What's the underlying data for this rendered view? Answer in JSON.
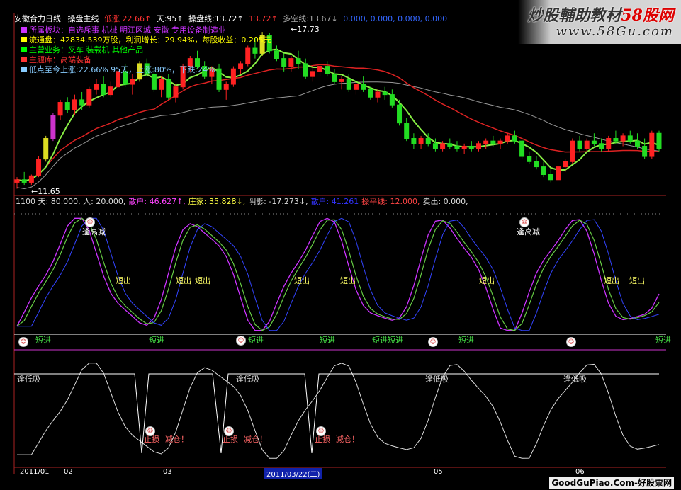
{
  "watermark": {
    "brand": "炒股輔助教材",
    "brand_num": "58股网",
    "url": "www.58Gu.com"
  },
  "top": {
    "title": "安徽合力日线",
    "ind": "操盘主线",
    "low_label": "低涨",
    "low_val": "22.66↑",
    "days": "天:95↑",
    "op_line": "操盘线:13.72↑",
    "op2": "13.72↑",
    "multi": "多空线:13.67↓",
    "zeros": "0.000, 0.000, 0.000, 0.000",
    "info": [
      {
        "text": "所属板块：自选斥事 机械 明江区城 安徽 专用设备制造业",
        "color": "#cc33ff"
      },
      {
        "text": "流通盘：42834.539万股，利润增长：29.94%，每股收益：0.205元",
        "color": "#ffff00"
      },
      {
        "text": "主营业务：叉车 装载机 其他产品",
        "color": "#00ff00"
      },
      {
        "text": "主题库：高端装备",
        "color": "#ff3333"
      },
      {
        "text": "低点至今上涨:22.66% 95天，上涨:80%，下跌:24%",
        "color": "#88ccff"
      }
    ],
    "high": "17.73",
    "low": "11.65"
  },
  "mid": {
    "header": [
      {
        "t": "1100 天: 80.000, 人: 20.000,",
        "c": "#ddd"
      },
      {
        "t": "散户: 46.627↑,",
        "c": "#ff44ff"
      },
      {
        "t": "庄家: 35.828↓,",
        "c": "#ffff44"
      },
      {
        "t": "阴影: -17.273↓,",
        "c": "#ddd"
      },
      {
        "t": "散户: 41.261",
        "c": "#3333ff"
      },
      {
        "t": "操平线: 12.000,",
        "c": "#ff4444"
      },
      {
        "t": "卖出: 0.000,",
        "c": "#ddd"
      }
    ],
    "sell_high": "逢高减",
    "short_out": "短出",
    "short_in": "短进"
  },
  "low": {
    "buy_low": "逢低吸",
    "stop": "止损",
    "reduce": "减仓！",
    "face": "☹"
  },
  "dates": [
    "2011/01",
    "02",
    "03",
    "2011/03/22(二)",
    "05",
    "06"
  ],
  "footer": "GoodGuPiao.Com-好股票网",
  "chart_data": [
    {
      "type": "candlestick",
      "title": "安徽合力日线",
      "ohlc": [
        [
          11.9,
          12.1,
          11.65,
          12.0
        ],
        [
          12.0,
          12.3,
          11.8,
          11.9
        ],
        [
          11.9,
          12.2,
          11.8,
          12.15
        ],
        [
          12.15,
          12.9,
          12.1,
          12.8
        ],
        [
          12.8,
          13.7,
          12.7,
          13.6
        ],
        [
          13.6,
          14.6,
          13.5,
          14.5
        ],
        [
          14.5,
          15.1,
          14.3,
          15.0
        ],
        [
          15.0,
          15.2,
          14.6,
          14.7
        ],
        [
          14.7,
          15.3,
          14.5,
          15.1
        ],
        [
          15.1,
          15.4,
          14.7,
          14.9
        ],
        [
          14.9,
          15.6,
          14.8,
          15.5
        ],
        [
          15.5,
          15.9,
          15.3,
          15.7
        ],
        [
          15.7,
          16.0,
          15.2,
          15.3
        ],
        [
          15.3,
          15.8,
          15.2,
          15.6
        ],
        [
          15.6,
          16.3,
          15.5,
          16.2
        ],
        [
          16.2,
          16.5,
          15.6,
          15.7
        ],
        [
          15.7,
          16.1,
          15.3,
          15.9
        ],
        [
          15.9,
          16.6,
          15.8,
          16.5
        ],
        [
          16.5,
          16.7,
          16.0,
          16.1
        ],
        [
          16.1,
          16.4,
          15.4,
          15.5
        ],
        [
          15.5,
          16.0,
          15.2,
          15.9
        ],
        [
          15.9,
          16.1,
          15.1,
          15.2
        ],
        [
          15.2,
          15.7,
          15.0,
          15.6
        ],
        [
          15.6,
          16.5,
          15.5,
          16.4
        ],
        [
          16.4,
          16.8,
          16.2,
          16.7
        ],
        [
          16.7,
          17.0,
          16.3,
          16.4
        ],
        [
          16.4,
          16.6,
          15.9,
          16.0
        ],
        [
          16.0,
          16.4,
          15.7,
          16.3
        ],
        [
          16.3,
          16.5,
          15.4,
          15.5
        ],
        [
          15.5,
          15.8,
          15.1,
          15.7
        ],
        [
          15.7,
          16.4,
          15.6,
          16.3
        ],
        [
          16.3,
          16.6,
          16.1,
          16.5
        ],
        [
          16.5,
          17.2,
          16.4,
          17.1
        ],
        [
          17.1,
          17.5,
          16.7,
          16.9
        ],
        [
          16.9,
          17.73,
          16.8,
          17.6
        ],
        [
          17.6,
          17.7,
          16.9,
          17.0
        ],
        [
          17.0,
          17.2,
          16.6,
          16.7
        ],
        [
          16.7,
          16.9,
          16.2,
          16.4
        ],
        [
          16.4,
          16.8,
          16.2,
          16.7
        ],
        [
          16.7,
          17.0,
          16.3,
          16.5
        ],
        [
          16.5,
          16.7,
          15.9,
          16.0
        ],
        [
          16.0,
          16.4,
          15.8,
          16.2
        ],
        [
          16.2,
          16.5,
          16.0,
          16.4
        ],
        [
          16.4,
          16.6,
          16.0,
          16.1
        ],
        [
          16.1,
          16.3,
          15.7,
          15.8
        ],
        [
          15.8,
          16.0,
          15.5,
          15.9
        ],
        [
          15.9,
          16.1,
          15.4,
          15.5
        ],
        [
          15.5,
          15.8,
          15.3,
          15.7
        ],
        [
          15.7,
          16.0,
          15.4,
          15.5
        ],
        [
          15.5,
          15.6,
          15.1,
          15.2
        ],
        [
          15.2,
          15.5,
          15.0,
          15.4
        ],
        [
          15.4,
          15.6,
          15.1,
          15.3
        ],
        [
          15.3,
          15.5,
          14.8,
          14.9
        ],
        [
          14.9,
          15.1,
          14.1,
          14.2
        ],
        [
          14.2,
          14.4,
          13.5,
          13.6
        ],
        [
          13.6,
          13.8,
          13.2,
          13.4
        ],
        [
          13.4,
          13.7,
          13.2,
          13.6
        ],
        [
          13.6,
          13.8,
          13.3,
          13.4
        ],
        [
          13.4,
          13.6,
          13.1,
          13.2
        ],
        [
          13.2,
          13.5,
          13.1,
          13.4
        ],
        [
          13.4,
          13.6,
          13.2,
          13.3
        ],
        [
          13.3,
          13.5,
          13.1,
          13.2
        ],
        [
          13.2,
          13.4,
          13.0,
          13.3
        ],
        [
          13.3,
          13.5,
          13.1,
          13.2
        ],
        [
          13.2,
          13.5,
          13.1,
          13.4
        ],
        [
          13.4,
          13.6,
          13.2,
          13.5
        ],
        [
          13.5,
          13.7,
          13.3,
          13.4
        ],
        [
          13.4,
          13.6,
          13.2,
          13.5
        ],
        [
          13.5,
          13.8,
          13.4,
          13.7
        ],
        [
          13.7,
          13.9,
          13.4,
          13.5
        ],
        [
          13.5,
          13.6,
          12.8,
          12.9
        ],
        [
          12.9,
          13.1,
          12.6,
          12.7
        ],
        [
          12.7,
          12.9,
          12.4,
          12.5
        ],
        [
          12.5,
          12.7,
          12.1,
          12.2
        ],
        [
          12.2,
          12.4,
          11.9,
          12.0
        ],
        [
          12.0,
          12.6,
          11.9,
          12.5
        ],
        [
          12.5,
          12.8,
          12.3,
          12.7
        ],
        [
          12.7,
          13.6,
          12.6,
          13.5
        ],
        [
          13.5,
          13.7,
          13.1,
          13.2
        ],
        [
          13.2,
          13.6,
          13.1,
          13.5
        ],
        [
          13.5,
          13.8,
          13.3,
          13.4
        ],
        [
          13.4,
          13.6,
          13.1,
          13.2
        ],
        [
          13.2,
          13.7,
          13.1,
          13.6
        ],
        [
          13.6,
          13.9,
          13.4,
          13.5
        ],
        [
          13.5,
          13.8,
          13.3,
          13.7
        ],
        [
          13.7,
          13.9,
          13.4,
          13.5
        ],
        [
          13.5,
          13.8,
          13.2,
          13.3
        ],
        [
          13.3,
          13.6,
          12.8,
          12.9
        ],
        [
          12.9,
          13.9,
          12.8,
          13.8
        ],
        [
          13.8,
          13.9,
          13.1,
          13.2
        ]
      ]
    },
    {
      "type": "line",
      "series": [
        {
          "name": "散户"
        },
        {
          "name": "庄家"
        }
      ]
    },
    {
      "type": "line",
      "series": [
        {
          "name": "逢低吸"
        }
      ]
    }
  ]
}
